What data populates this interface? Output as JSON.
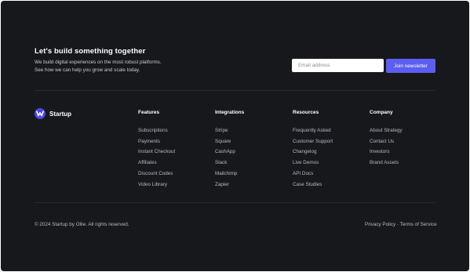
{
  "cta": {
    "title": "Let's build something together",
    "description_line1": "We build digital experiences on the most robust platforms.",
    "description_line2": "See how we can help you grow and scale today."
  },
  "newsletter": {
    "email_placeholder": "Email address",
    "button_label": "Join newsletter"
  },
  "brand": {
    "name": "Startup",
    "logo_icon": "wave-icon"
  },
  "columns": [
    {
      "title": "Features",
      "links": [
        "Subscriptions",
        "Payments",
        "Instant Checkout",
        "Affiliates",
        "Discount Codes",
        "Video Library"
      ]
    },
    {
      "title": "Integrations",
      "links": [
        "Stripe",
        "Square",
        "CashApp",
        "Slack",
        "Mailchimp",
        "Zapier"
      ]
    },
    {
      "title": "Resources",
      "links": [
        "Frequently Asked",
        "Customer Support",
        "Changelog",
        "Live Demos",
        "API Docs",
        "Case Studies"
      ]
    },
    {
      "title": "Company",
      "links": [
        "About Strategy",
        "Contact Us",
        "Investors",
        "Brand Assets"
      ]
    }
  ],
  "bottom": {
    "copyright": "© 2024 Startup by Ollie. All rights reserved.",
    "privacy": "Privacy Policy",
    "separator": "·",
    "terms": "Terms of Service"
  },
  "colors": {
    "background": "#17181c",
    "accent": "#5b5ef0"
  }
}
